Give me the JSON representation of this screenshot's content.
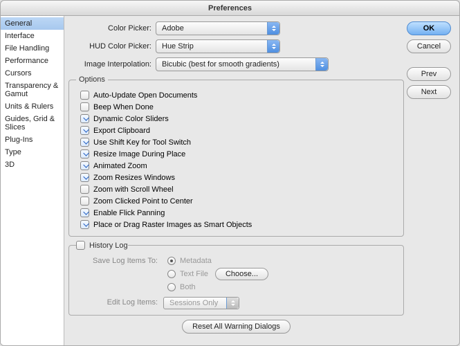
{
  "title": "Preferences",
  "sidebar": {
    "items": [
      {
        "label": "General"
      },
      {
        "label": "Interface"
      },
      {
        "label": "File Handling"
      },
      {
        "label": "Performance"
      },
      {
        "label": "Cursors"
      },
      {
        "label": "Transparency & Gamut"
      },
      {
        "label": "Units & Rulers"
      },
      {
        "label": "Guides, Grid & Slices"
      },
      {
        "label": "Plug-Ins"
      },
      {
        "label": "Type"
      },
      {
        "label": "3D"
      }
    ]
  },
  "pickers": {
    "color_label": "Color Picker:",
    "color_value": "Adobe",
    "hud_label": "HUD Color Picker:",
    "hud_value": "Hue Strip",
    "interp_label": "Image Interpolation:",
    "interp_value": "Bicubic (best for smooth gradients)"
  },
  "options": {
    "legend": "Options",
    "items": [
      {
        "label": "Auto-Update Open Documents",
        "checked": false
      },
      {
        "label": "Beep When Done",
        "checked": false
      },
      {
        "label": "Dynamic Color Sliders",
        "checked": true
      },
      {
        "label": "Export Clipboard",
        "checked": true
      },
      {
        "label": "Use Shift Key for Tool Switch",
        "checked": true
      },
      {
        "label": "Resize Image During Place",
        "checked": true
      },
      {
        "label": "Animated Zoom",
        "checked": true
      },
      {
        "label": "Zoom Resizes Windows",
        "checked": true
      },
      {
        "label": "Zoom with Scroll Wheel",
        "checked": false
      },
      {
        "label": "Zoom Clicked Point to Center",
        "checked": false
      },
      {
        "label": "Enable Flick Panning",
        "checked": true
      },
      {
        "label": "Place or Drag Raster Images as Smart Objects",
        "checked": true
      }
    ]
  },
  "history": {
    "legend": "History Log",
    "save_label": "Save Log Items To:",
    "choices": [
      {
        "label": "Metadata",
        "on": true
      },
      {
        "label": "Text File",
        "on": false
      },
      {
        "label": "Both",
        "on": false
      }
    ],
    "choose_btn": "Choose...",
    "edit_label": "Edit Log Items:",
    "edit_value": "Sessions Only"
  },
  "reset_btn": "Reset All Warning Dialogs",
  "buttons": {
    "ok": "OK",
    "cancel": "Cancel",
    "prev": "Prev",
    "next": "Next"
  }
}
